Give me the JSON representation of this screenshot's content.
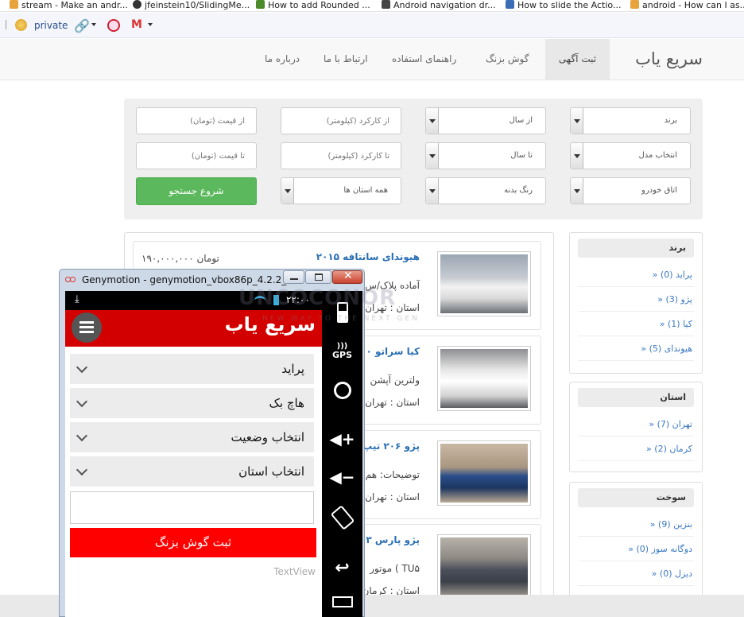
{
  "bookmarks": [
    {
      "label": "stream - Make an andr...",
      "color": "#e8a33b"
    },
    {
      "label": "jfeinstein10/SlidingMe...",
      "color": "#333333"
    },
    {
      "label": "How to add Rounded ...",
      "color": "#4a8a2a"
    },
    {
      "label": "Android navigation dr...",
      "color": "#444444"
    },
    {
      "label": "How to slide the Actio...",
      "color": "#3a6db5"
    },
    {
      "label": "android - How can I as...",
      "color": "#e8a33b"
    }
  ],
  "toolbar": {
    "private_label": "private"
  },
  "nav": {
    "brand": "سریع یاب",
    "items": [
      "ثبت آگهی",
      "گوش بزنگ",
      "راهنمای استفاده",
      "ارتباط با ما",
      "درباره ما"
    ]
  },
  "search": {
    "brand_select": "برند",
    "model_select": "انتخاب مدل",
    "body_select": "اتاق خودرو",
    "year_from": "از سال",
    "year_to": "تا سال",
    "color_select": "رنگ بدنه",
    "km_from": "از کارکرد (کیلومتر)",
    "km_to": "تا کارکرد (کیلومتر)",
    "province_select": "همه استان ها",
    "price_from": "از قیمت (تومان)",
    "price_to": "تا قیمت (تومان)",
    "button": "شروع جستجو"
  },
  "sidebar": {
    "brand": {
      "title": "برند",
      "items": [
        "» پراید (0)",
        "» پژو (3)",
        "» کیا (1)",
        "» هیوندای (5)"
      ]
    },
    "province": {
      "title": "استان",
      "items": [
        "» تهران (7)",
        "» کرمان (2)"
      ]
    },
    "fuel": {
      "title": "سوخت",
      "items": [
        "» بنزین (9)",
        "» دوگانه سوز (0)",
        "» دیزل (0)"
      ]
    }
  },
  "listings": [
    {
      "title": "هیوندای سانتافه ۲۰۱۵",
      "price": "۱۹۰,۰۰۰,۰۰۰ تومان",
      "desc": "آماده پلاک/س",
      "location": "استان : تهران"
    },
    {
      "title": "کیا سراتو ۲۰۰",
      "desc": "ولترین آپشن",
      "location": "استان : تهران"
    },
    {
      "title": "پژو ۲۰۶ تیپ",
      "desc": "توضیحات: هم",
      "location": "استان : تهران"
    },
    {
      "title": "پژو پارس ۳",
      "desc": "موتور ( TU۵",
      "location": "استان : کرمان"
    }
  ],
  "genymotion": {
    "title": "Genymotion - genymotion_vbox86p_4.2.2_1...",
    "clock": "۲۲:۰۰",
    "app_title": "سریع یاب",
    "spinners": [
      "پراید",
      "هاچ بک",
      "انتخاب وضعیت",
      "انتخاب استان"
    ],
    "register_button": "ثبت گوش بزنگ",
    "textview": "TextView",
    "gps_label": "GPS"
  },
  "watermark": {
    "main": "UNCOCONOR",
    "sub": "NEW WAY TO THE NEXT GEN"
  }
}
